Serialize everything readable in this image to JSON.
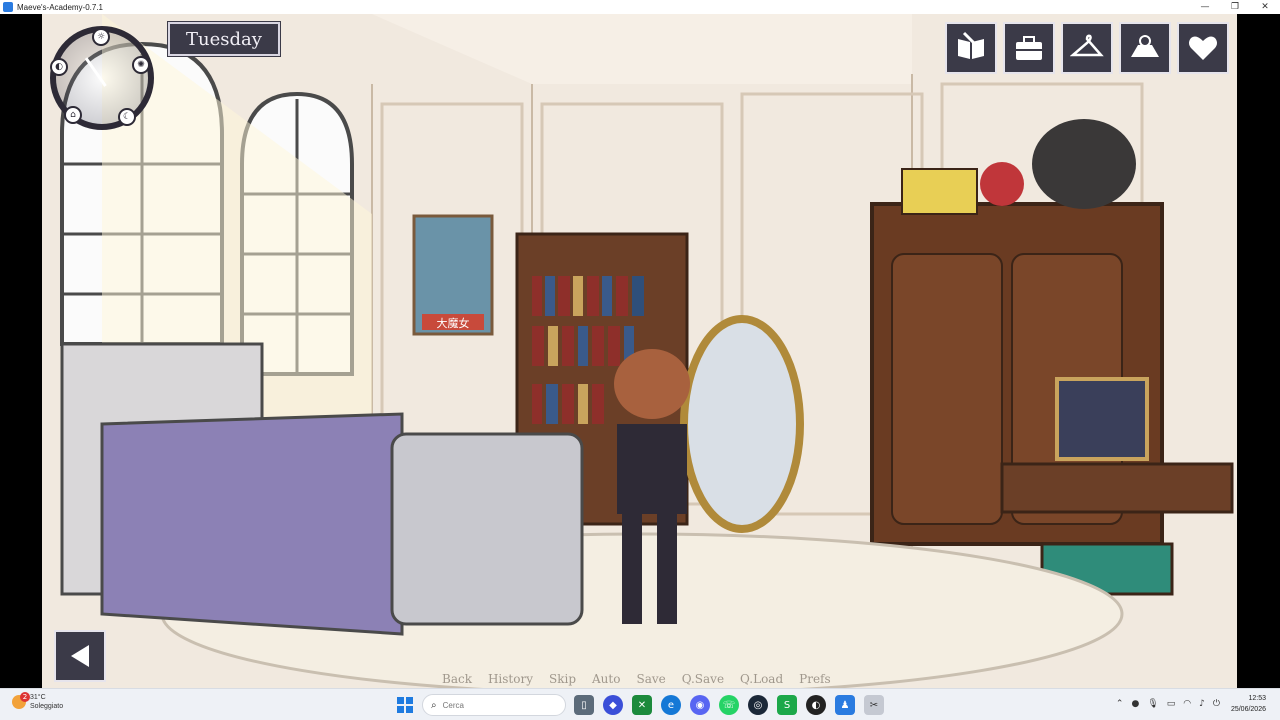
{
  "window": {
    "title": "Maeve's-Academy-0.7.1",
    "controls": [
      "—",
      "❐",
      "✕"
    ]
  },
  "hud": {
    "day": "Tuesday",
    "menu_buttons": [
      {
        "name": "journal-icon"
      },
      {
        "name": "briefcase-icon"
      },
      {
        "name": "hanger-icon"
      },
      {
        "name": "map-icon"
      },
      {
        "name": "heart-icon"
      }
    ],
    "clock_icons": [
      "sunrise-icon",
      "day-icon",
      "evening-icon",
      "night-icon",
      "home-icon"
    ],
    "back_button": "back-arrow-icon"
  },
  "quick_menu": [
    "Back",
    "History",
    "Skip",
    "Auto",
    "Save",
    "Q.Save",
    "Q.Load",
    "Prefs"
  ],
  "scene": {
    "poster_text": "大魔女"
  },
  "taskbar": {
    "weather_temp": "31°C",
    "weather_desc": "Soleggiato",
    "notification_count": "2",
    "search_placeholder": "Cerca",
    "time": "12:53",
    "date": "25/06/2026"
  },
  "colors": {
    "ui_panel": "#3b3a48",
    "ui_border": "#e6e4ec",
    "taskbar": "#eef1f6"
  }
}
